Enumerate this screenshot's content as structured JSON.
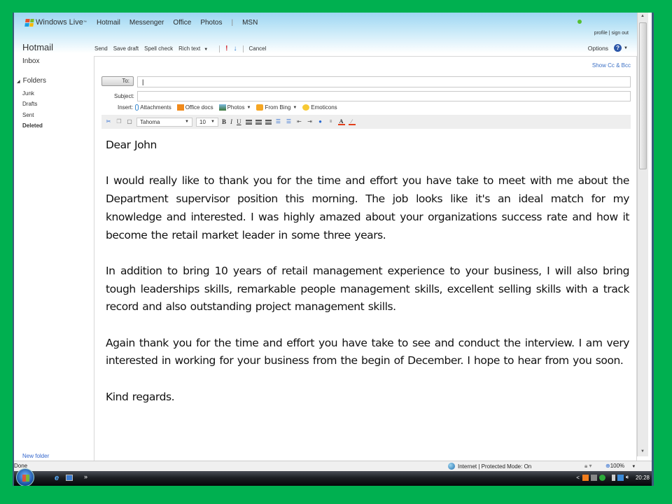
{
  "header": {
    "brand": "Windows Live",
    "nav": [
      "Hotmail",
      "Messenger",
      "Office",
      "Photos",
      "MSN"
    ],
    "nav_separator": "|",
    "profile_links": "profile | sign out"
  },
  "sidebar": {
    "app_title": "Hotmail",
    "inbox": "Inbox",
    "folders_label": "Folders",
    "folders": [
      "Junk",
      "Drafts",
      "Sent",
      "Deleted"
    ],
    "active_folder": "Deleted",
    "new_folder": "New folder"
  },
  "command_bar": {
    "send": "Send",
    "save_draft": "Save draft",
    "spell_check": "Spell check",
    "rich_text": "Rich text",
    "high_priority": "!",
    "low_priority": "↓",
    "cancel": "Cancel",
    "options": "Options",
    "help": "?"
  },
  "compose": {
    "show_cc_bcc": "Show Cc & Bcc",
    "to_label": "To:",
    "to_value": "|",
    "subject_label": "Subject:",
    "subject_value": "",
    "insert_label": "Insert:",
    "insert_items": [
      "Attachments",
      "Office docs",
      "Photos",
      "From Bing",
      "Emoticons"
    ],
    "font": "Tahoma",
    "font_size": "10",
    "format_buttons": [
      "B",
      "I",
      "U"
    ],
    "body": [
      "Dear John",
      "I would really like to thank you for the time and effort you have take to meet with me about the Department supervisor position this morning. The job looks like it's an ideal match for my knowledge and interested. I was highly amazed about your organizations success rate and how it become the retail market leader in some three years.",
      "In addition to bring 10 years of retail management experience to your business, I will also bring tough leaderships skills, remarkable people management skills, excellent selling skills with a track record and also outstanding project management skills.",
      "Again thank you for the time and effort you have take to see and conduct the interview. I am very interested in working for your business from the begin of December. I hope to hear from you soon.",
      "Kind regards."
    ]
  },
  "statusbar": {
    "status": "Done",
    "zone": "Internet | Protected Mode: On",
    "zoom": "100%"
  },
  "taskbar": {
    "quick_launch_more": "»",
    "tray_expand": "<",
    "clock": "20:28"
  },
  "colors": {
    "background_green": "#00b050",
    "link_blue": "#3a6fc4",
    "priority_red": "#d0202a"
  }
}
